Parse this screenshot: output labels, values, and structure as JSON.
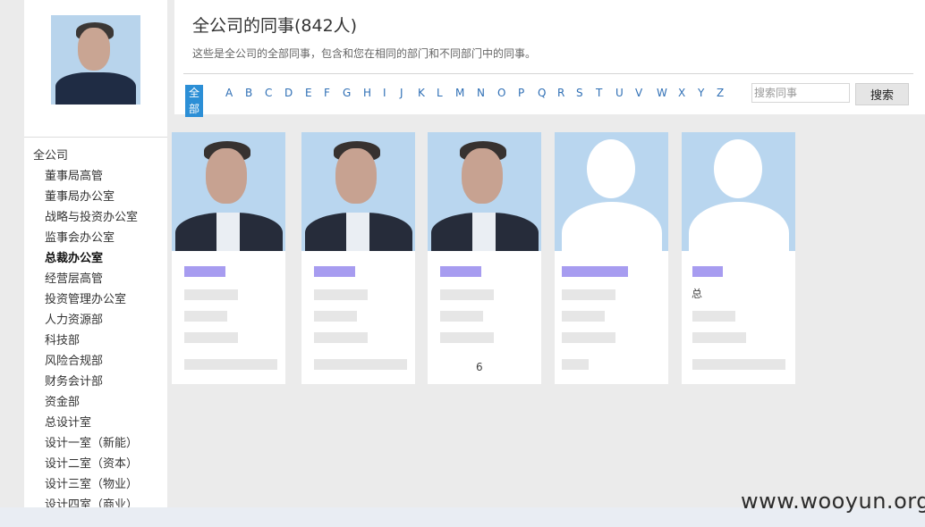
{
  "header": {
    "title": "全公司的同事(842人)",
    "description": "这些是全公司的全部同事，包含和您在相同的部门和不同部门中的同事。"
  },
  "letter_filter": {
    "active": "全部",
    "letters": [
      "A",
      "B",
      "C",
      "D",
      "E",
      "F",
      "G",
      "H",
      "I",
      "J",
      "K",
      "L",
      "M",
      "N",
      "O",
      "P",
      "Q",
      "R",
      "S",
      "T",
      "U",
      "V",
      "W",
      "X",
      "Y",
      "Z"
    ]
  },
  "search": {
    "placeholder": "搜索同事",
    "button_label": "搜索"
  },
  "sidebar": {
    "root_label": "全公司",
    "selected": "总裁办公室",
    "departments": [
      "董事局高管",
      "董事局办公室",
      "战略与投资办公室",
      "监事会办公室",
      "总裁办公室",
      "经营层高管",
      "投资管理办公室",
      "人力资源部",
      "科技部",
      "风险合规部",
      "财务会计部",
      "资金部",
      "总设计室",
      "设计一室（新能）",
      "设计二室（资本）",
      "设计三室（物业）",
      "设计四室（商业）"
    ]
  },
  "cards": [
    {
      "photo": "person-photo-blurred"
    },
    {
      "photo": "person-photo-blurred"
    },
    {
      "photo": "person-photo-blurred",
      "fragment": "6"
    },
    {
      "photo": "default-avatar-silhouette"
    },
    {
      "photo": "default-avatar-silhouette",
      "fragment": "总"
    }
  ],
  "watermark": "www.wooyun.org",
  "colors": {
    "accent": "#2c8fd6",
    "link": "#2f6fb5",
    "name_highlight": "#a79cf0",
    "photo_bg": "#b9d6ef"
  }
}
